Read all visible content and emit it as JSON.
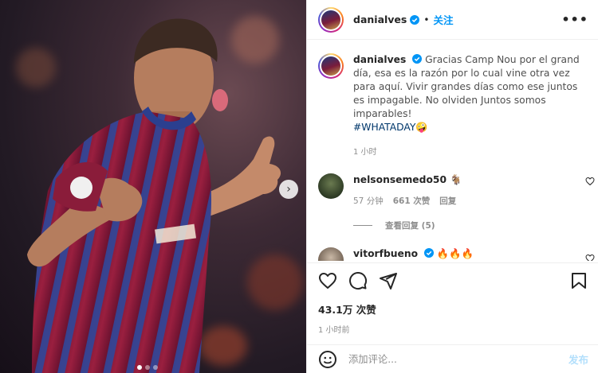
{
  "header": {
    "username": "danialves",
    "separator": "•",
    "follow_label": "关注",
    "more_label": "•••"
  },
  "caption": {
    "username": "danialves",
    "text": "Gracias Camp Nou por el grand día, esa es la razón por lo cual vine otra vez para aquí. Vivir grandes días como ese juntos es impagable. No olviden Juntos somos imparables!",
    "hashtag": "#WHATADAY",
    "emoji": "🤪",
    "time": "1 小时"
  },
  "comments": [
    {
      "username": "nelsonsemedo50",
      "text": "🐐",
      "time": "57 分钟",
      "likes": "661 次赞",
      "reply_label": "回复",
      "view_replies": "查看回复 (5)"
    },
    {
      "username": "vitorfbueno",
      "text": "🔥🔥🔥"
    }
  ],
  "actions": {
    "likes": "43.1万 次赞",
    "posted": "1 小时前"
  },
  "add_comment": {
    "placeholder": "添加评论...",
    "post_label": "发布"
  },
  "media": {
    "next_icon": "chevron-right-icon",
    "dots": 3,
    "active_dot": 0
  },
  "colors": {
    "accent": "#0095f6",
    "link": "#00376b",
    "muted": "#8e8e8e",
    "post_disabled": "#b2dffc"
  }
}
